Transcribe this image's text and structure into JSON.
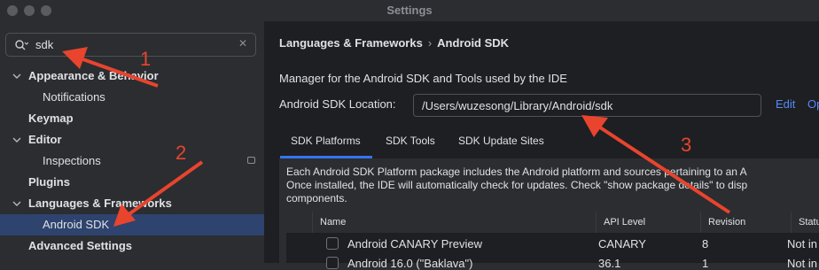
{
  "window": {
    "title": "Settings"
  },
  "sidebar": {
    "search": {
      "value": "sdk"
    },
    "items": [
      {
        "label": "Appearance & Behavior"
      },
      {
        "label": "Notifications"
      },
      {
        "label": "Keymap"
      },
      {
        "label": "Editor"
      },
      {
        "label": "Inspections"
      },
      {
        "label": "Plugins"
      },
      {
        "label": "Languages & Frameworks"
      },
      {
        "label": "Android SDK"
      },
      {
        "label": "Advanced Settings"
      }
    ]
  },
  "main": {
    "breadcrumb": {
      "parent": "Languages & Frameworks",
      "separator": "›",
      "current": "Android SDK"
    },
    "description": "Manager for the Android SDK and Tools used by the IDE",
    "location": {
      "label": "Android SDK Location:",
      "value": "/Users/wuzesong/Library/Android/sdk"
    },
    "edit_link": "Edit",
    "optimize_link": "Op",
    "tabs": [
      {
        "label": "SDK Platforms"
      },
      {
        "label": "SDK Tools"
      },
      {
        "label": "SDK Update Sites"
      }
    ],
    "panel_lines": [
      "Each Android SDK Platform package includes the Android platform and sources pertaining to an A",
      "Once installed, the IDE will automatically check for updates. Check \"show package details\" to disp",
      "components."
    ],
    "table": {
      "columns": [
        "Name",
        "API Level",
        "Revision",
        "Status"
      ],
      "rows": [
        {
          "name": "Android CANARY Preview",
          "api": "CANARY",
          "revision": "8",
          "status": "Not in"
        },
        {
          "name": "Android 16.0 (\"Baklava\")",
          "api": "36.1",
          "revision": "1",
          "status": "Not in"
        }
      ]
    }
  },
  "annotations": [
    "1",
    "2",
    "3"
  ],
  "colors": {
    "accent": "#3574f0",
    "selection": "#2e436e",
    "arrow": "#e8442e",
    "link": "#548af7"
  }
}
